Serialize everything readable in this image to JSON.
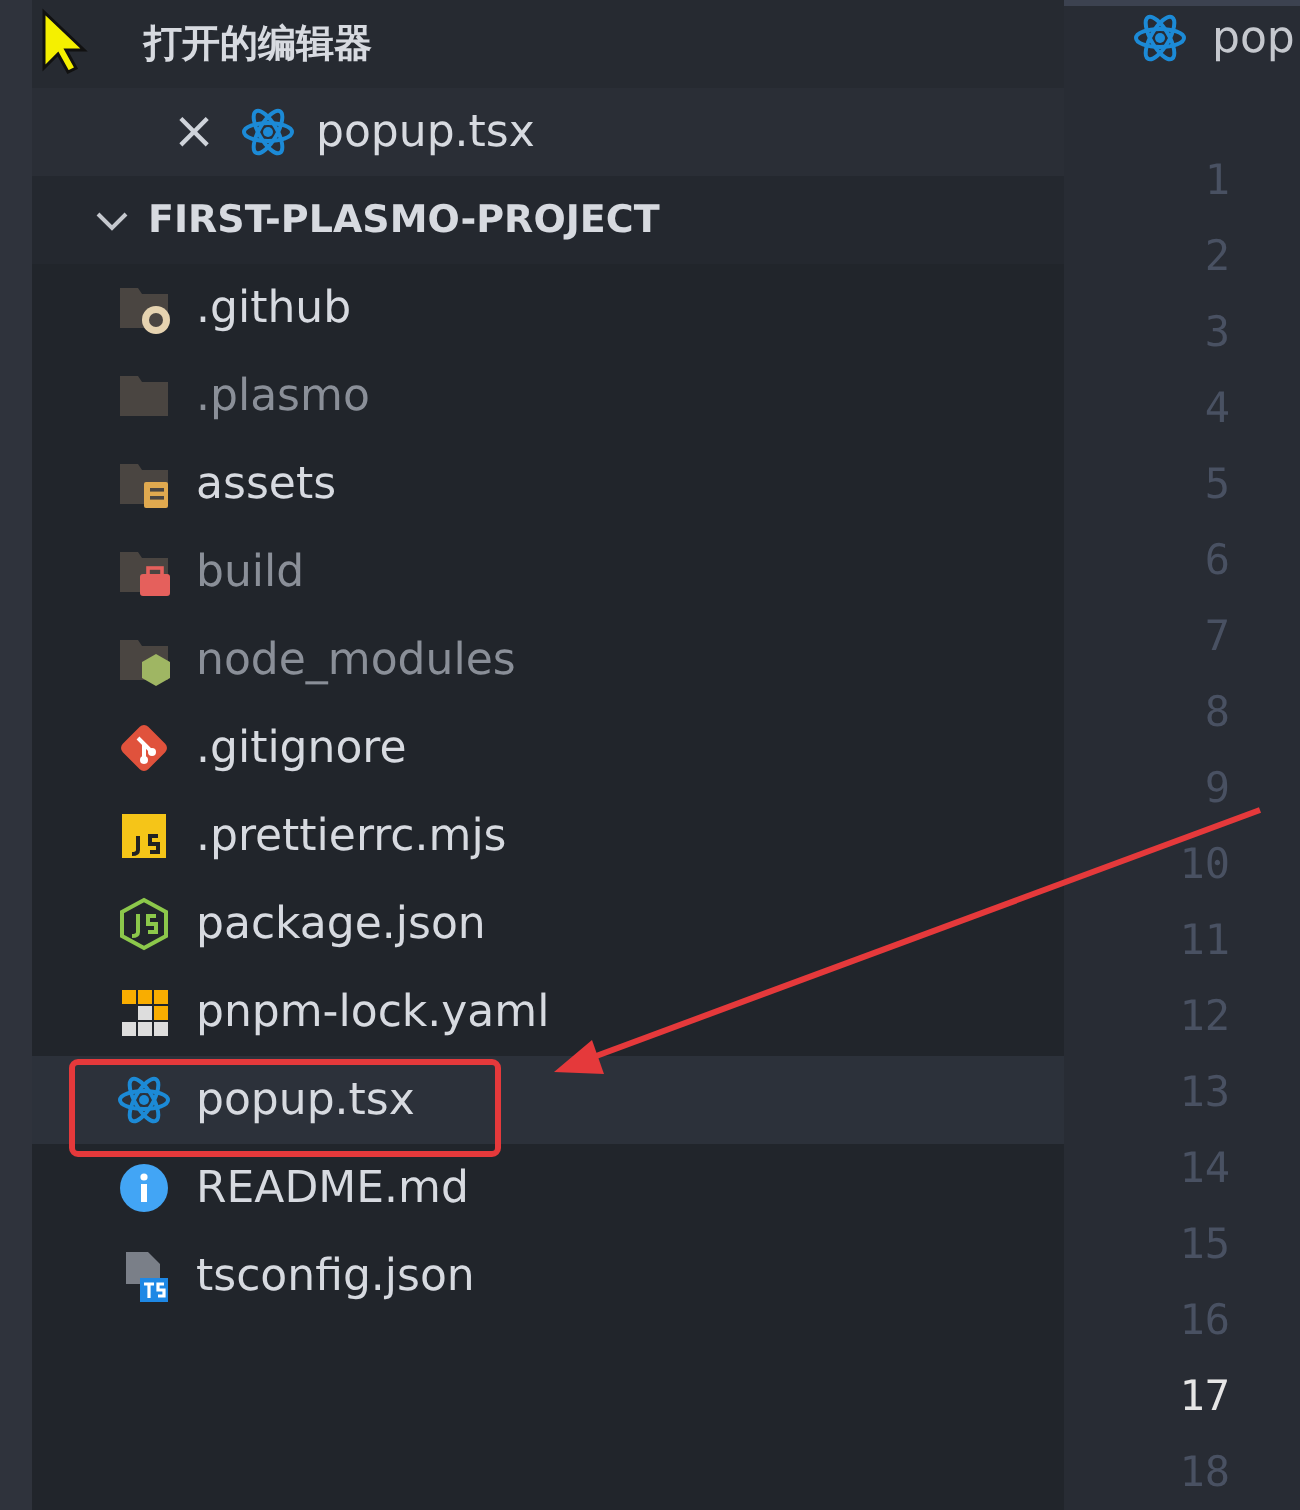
{
  "open_editors": {
    "title": "打开的编辑器",
    "files": [
      {
        "name": "popup.tsx",
        "kind": "react",
        "close": "×"
      }
    ]
  },
  "project": {
    "title": "FIRST-PLASMO-PROJECT",
    "expanded": true,
    "items": [
      {
        "name": ".github",
        "kind": "folder-github",
        "dimmed": false,
        "selected": false
      },
      {
        "name": ".plasmo",
        "kind": "folder",
        "dimmed": true,
        "selected": false
      },
      {
        "name": "assets",
        "kind": "folder-assets",
        "dimmed": false,
        "selected": false
      },
      {
        "name": "build",
        "kind": "folder-build",
        "dimmed": true,
        "selected": false
      },
      {
        "name": "node_modules",
        "kind": "folder-node",
        "dimmed": true,
        "selected": false
      },
      {
        "name": ".gitignore",
        "kind": "git",
        "dimmed": false,
        "selected": false
      },
      {
        "name": ".prettierrc.mjs",
        "kind": "js",
        "dimmed": false,
        "selected": false
      },
      {
        "name": "package.json",
        "kind": "nodejs",
        "dimmed": false,
        "selected": false
      },
      {
        "name": "pnpm-lock.yaml",
        "kind": "pnpm",
        "dimmed": false,
        "selected": false
      },
      {
        "name": "popup.tsx",
        "kind": "react",
        "dimmed": false,
        "selected": true
      },
      {
        "name": "README.md",
        "kind": "info",
        "dimmed": false,
        "selected": false
      },
      {
        "name": "tsconfig.json",
        "kind": "ts",
        "dimmed": false,
        "selected": false
      }
    ]
  },
  "editor": {
    "tab": {
      "label": "pop",
      "kind": "react"
    },
    "line_numbers": [
      {
        "n": "1",
        "current": false
      },
      {
        "n": "2",
        "current": false
      },
      {
        "n": "3",
        "current": false
      },
      {
        "n": "4",
        "current": false
      },
      {
        "n": "5",
        "current": false
      },
      {
        "n": "6",
        "current": false
      },
      {
        "n": "7",
        "current": false
      },
      {
        "n": "8",
        "current": false
      },
      {
        "n": "9",
        "current": false
      },
      {
        "n": "10",
        "current": false
      },
      {
        "n": "11",
        "current": false
      },
      {
        "n": "12",
        "current": false
      },
      {
        "n": "13",
        "current": false
      },
      {
        "n": "14",
        "current": false
      },
      {
        "n": "15",
        "current": false
      },
      {
        "n": "16",
        "current": false
      },
      {
        "n": "17",
        "current": true
      },
      {
        "n": "18",
        "current": false
      }
    ]
  }
}
